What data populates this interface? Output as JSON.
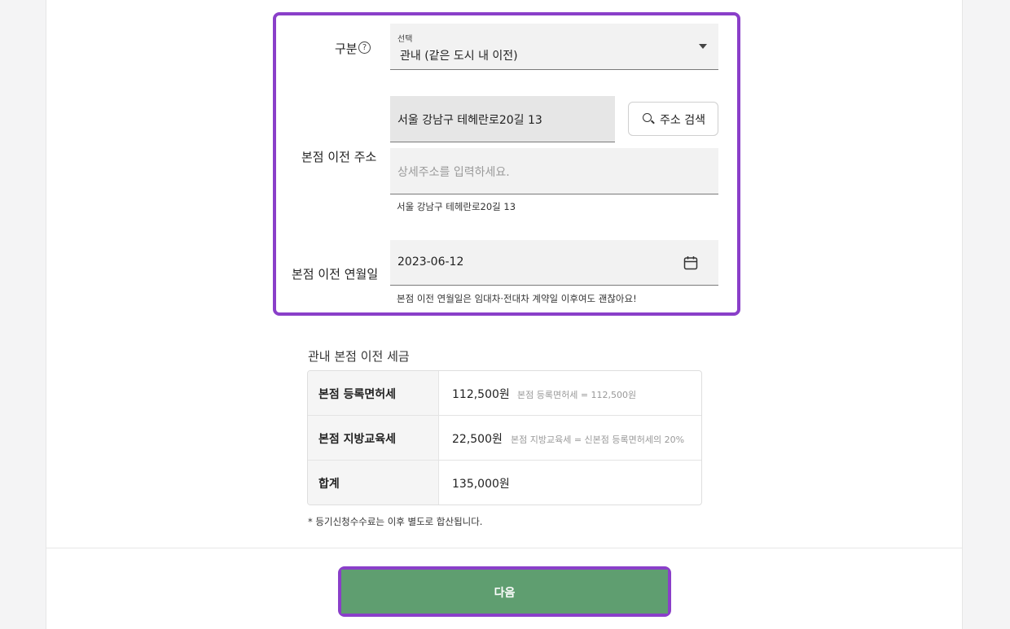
{
  "form": {
    "category": {
      "label": "구분",
      "help_icon": "?",
      "select_small_label": "선택",
      "selected_value": "관내 (같은 도시 내 이전)"
    },
    "address": {
      "label": "본점 이전 주소",
      "value": "서울 강남구 테헤란로20길 13",
      "search_button": "주소 검색",
      "detail_placeholder": "상세주소를 입력하세요.",
      "helper": "서울 강남구 테헤란로20길 13"
    },
    "date": {
      "label": "본점 이전 연월일",
      "value": "2023-06-12",
      "helper": "본점 이전 연월일은 임대차·전대차 계약일 이후여도 괜찮아요!"
    }
  },
  "tax": {
    "title": "관내 본점 이전 세금",
    "rows": [
      {
        "head": "본점 등록면허세",
        "amount": "112,500원",
        "note": "본점 등록면허세 = 112,500원"
      },
      {
        "head": "본점 지방교육세",
        "amount": "22,500원",
        "note": "본점 지방교육세 = 신본점 등록면허세의 20%"
      },
      {
        "head": "합계",
        "amount": "135,000원",
        "note": ""
      }
    ],
    "footnote": "* 등기신청수수료는 이후 별도로 합산됩니다."
  },
  "next_button": "다음",
  "colors": {
    "highlight": "#8a3fc9",
    "next_button": "#5f9e70"
  },
  "icons": {
    "help": "help-circle-icon",
    "dropdown": "caret-down-icon",
    "search": "search-icon",
    "calendar": "calendar-icon"
  }
}
